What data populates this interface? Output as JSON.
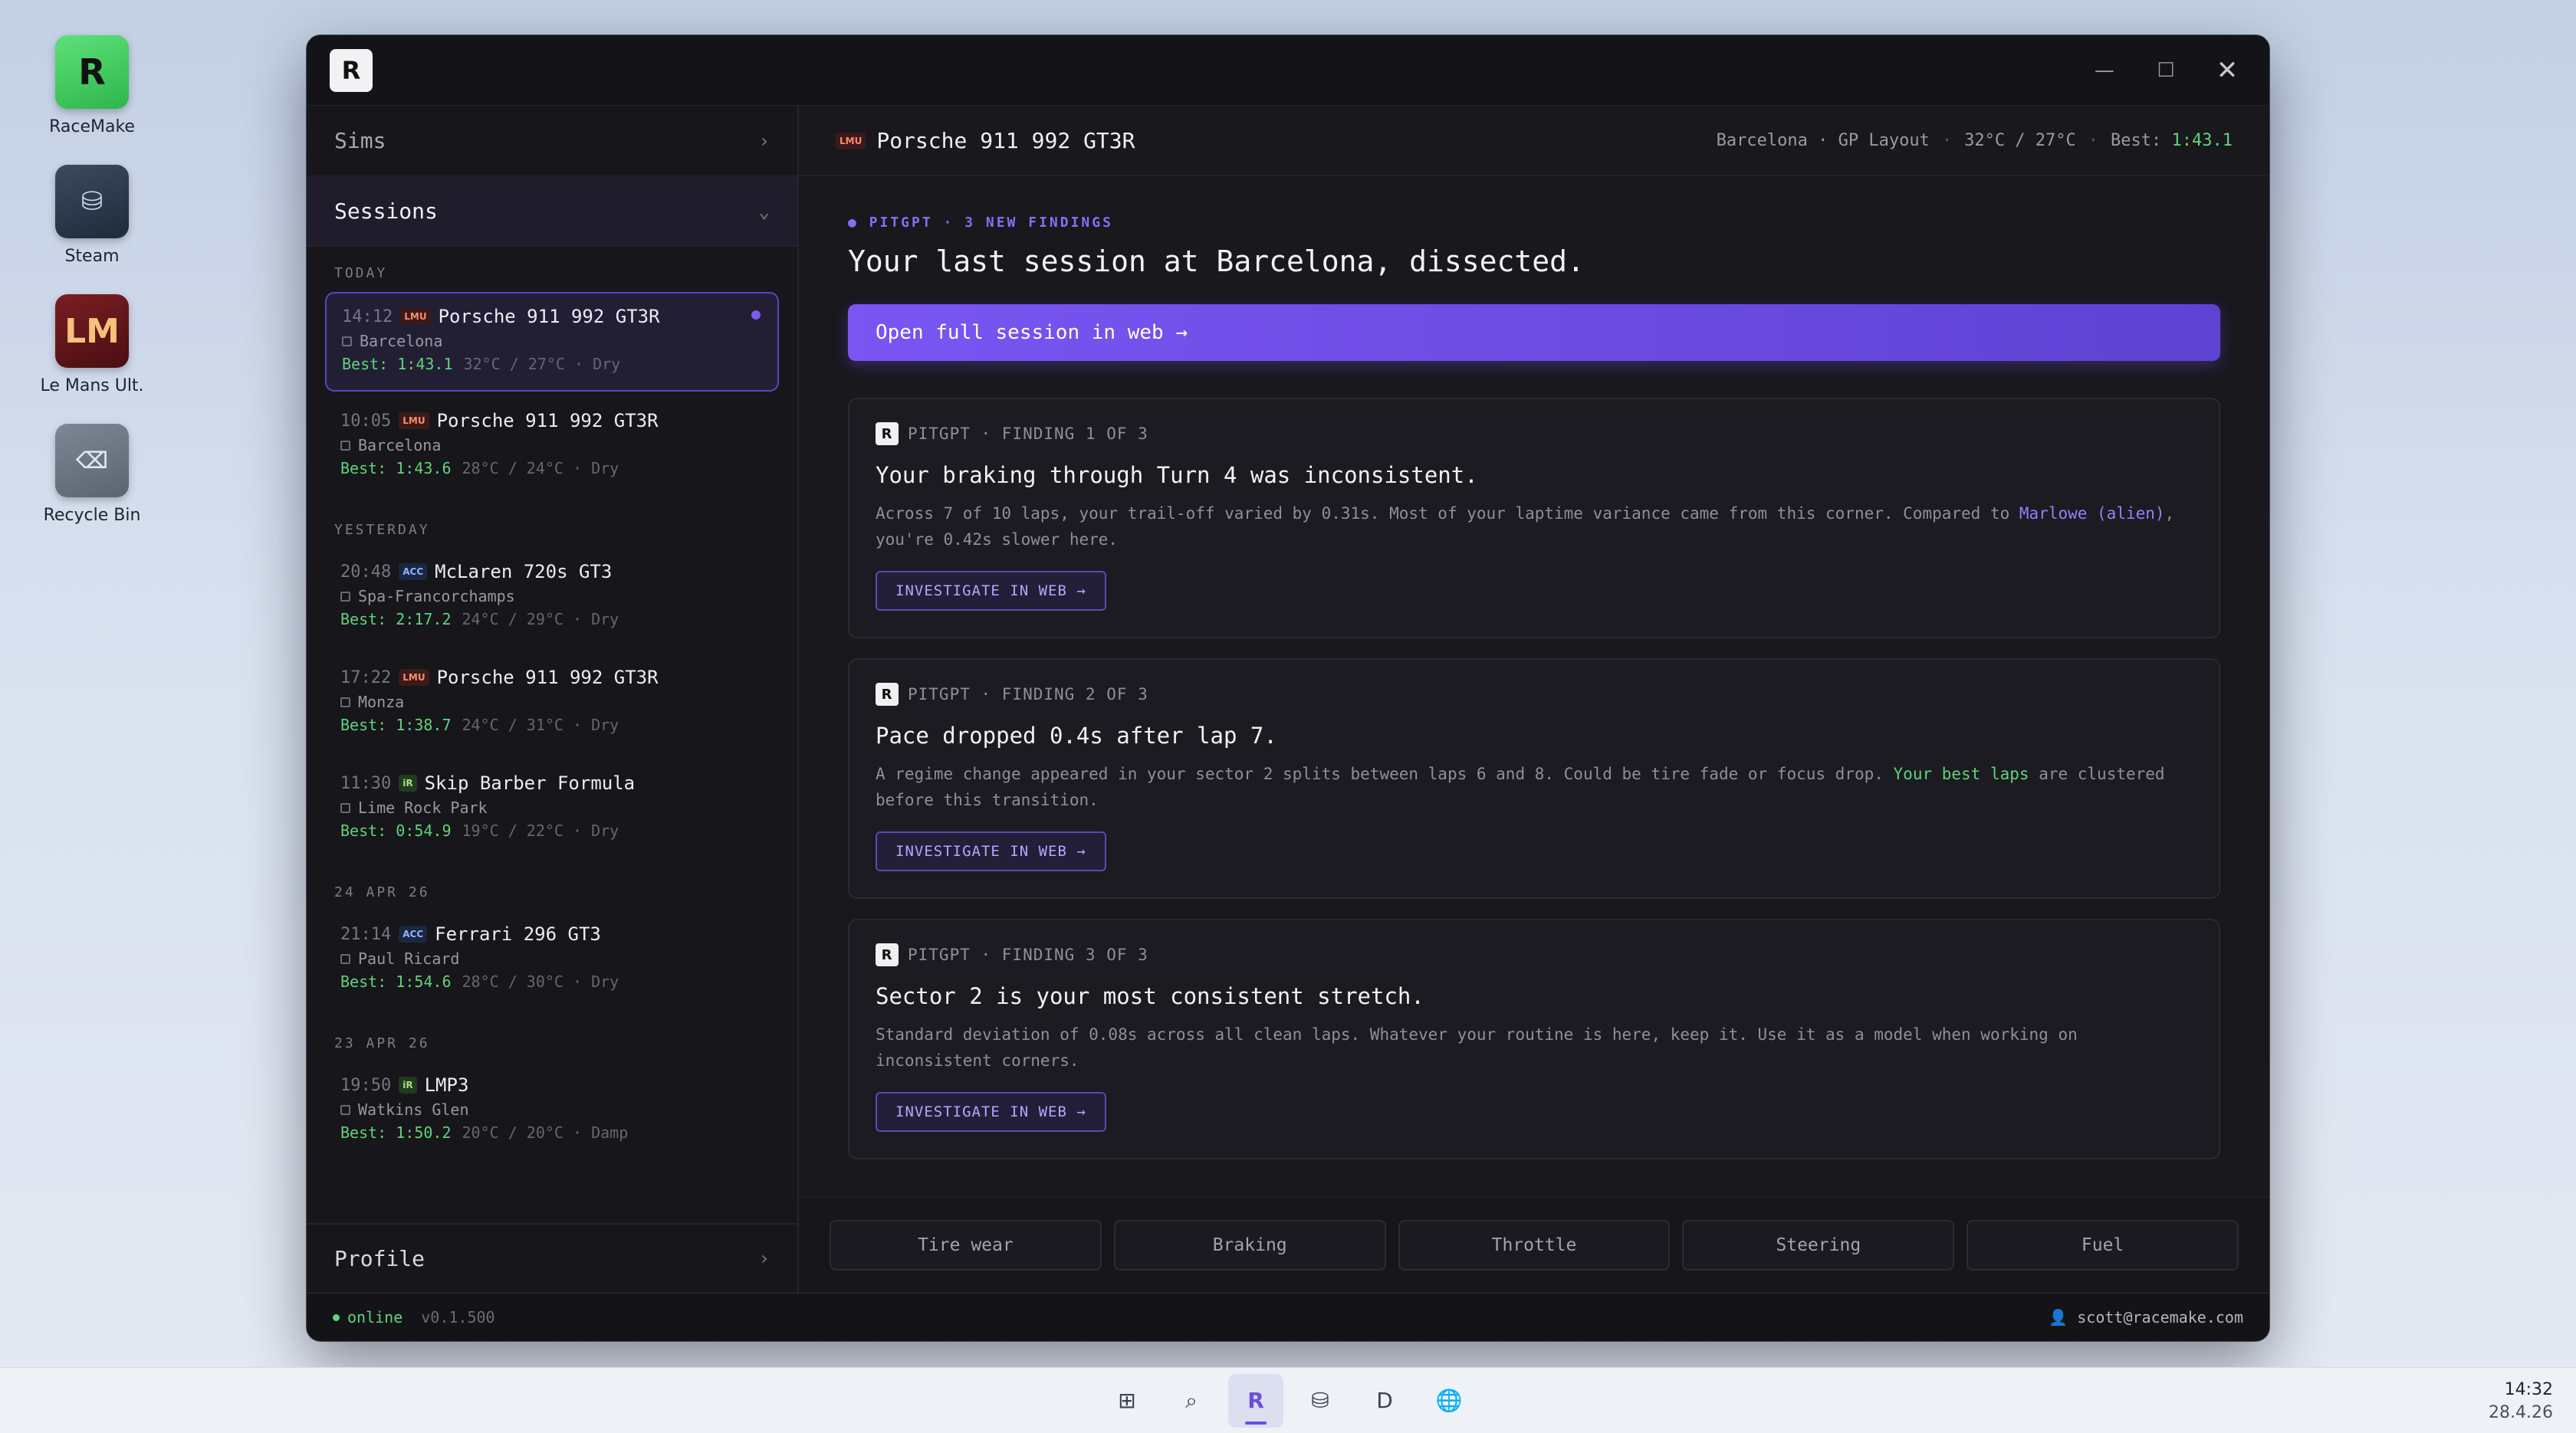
{
  "desktop": {
    "icons": [
      {
        "label": "RaceMake",
        "glyph": "R",
        "icon": "racemake-app-icon"
      },
      {
        "label": "Steam",
        "glyph": "⛁",
        "icon": "steam-app-icon"
      },
      {
        "label": "Le Mans Ult.",
        "glyph": "LM",
        "icon": "lemans-app-icon"
      },
      {
        "label": "Recycle Bin",
        "glyph": "⌫",
        "icon": "recycle-bin-icon"
      }
    ]
  },
  "window": {
    "logo": "R",
    "controls": {
      "minimize": "—",
      "maximize": "☐",
      "close": "✕"
    }
  },
  "sidebar": {
    "sims_label": "Sims",
    "sessions_label": "Sessions",
    "profile_label": "Profile",
    "chevron_right": "›",
    "chevron_down": "⌄",
    "groups": [
      {
        "label": "TODAY",
        "sessions": [
          {
            "time": "14:12",
            "sim": "LMU",
            "car": "Porsche 911 992 GT3R",
            "track": "Barcelona",
            "best": "Best: 1:43.1",
            "weather": "32°C / 27°C · Dry"
          },
          {
            "time": "10:05",
            "sim": "LMU",
            "car": "Porsche 911 992 GT3R",
            "track": "Barcelona",
            "best": "Best: 1:43.6",
            "weather": "28°C / 24°C · Dry"
          }
        ]
      },
      {
        "label": "YESTERDAY",
        "sessions": [
          {
            "time": "20:48",
            "sim": "ACC",
            "car": "McLaren 720s GT3",
            "track": "Spa-Francorchamps",
            "best": "Best: 2:17.2",
            "weather": "24°C / 29°C · Dry"
          },
          {
            "time": "17:22",
            "sim": "LMU",
            "car": "Porsche 911 992 GT3R",
            "track": "Monza",
            "best": "Best: 1:38.7",
            "weather": "24°C / 31°C · Dry"
          },
          {
            "time": "11:30",
            "sim": "iR",
            "car": "Skip Barber Formula",
            "track": "Lime Rock Park",
            "best": "Best: 0:54.9",
            "weather": "19°C / 22°C · Dry"
          }
        ]
      },
      {
        "label": "24 APR 26",
        "sessions": [
          {
            "time": "21:14",
            "sim": "ACC",
            "car": "Ferrari 296 GT3",
            "track": "Paul Ricard",
            "best": "Best: 1:54.6",
            "weather": "28°C / 30°C · Dry"
          }
        ]
      },
      {
        "label": "23 APR 26",
        "sessions": [
          {
            "time": "19:50",
            "sim": "iR",
            "car": "LMP3",
            "track": "Watkins Glen",
            "best": "Best: 1:50.2",
            "weather": "20°C / 20°C · Damp"
          }
        ]
      }
    ]
  },
  "main": {
    "header": {
      "sim": "LMU",
      "car": "Porsche 911 992 GT3R",
      "track": "Barcelona · GP Layout",
      "temps": "32°C / 27°C",
      "dot": "·",
      "best_label": "Best:",
      "best_value": "1:43.1"
    },
    "eyebrow": "● PITGPT · 3 NEW FINDINGS",
    "headline": "Your last session at Barcelona, dissected.",
    "cta": "Open full session in web →",
    "findings": [
      {
        "meta": "PITGPT · FINDING 1 OF 3",
        "title": "Your braking through Turn 4 was inconsistent.",
        "desc_before": "Across 7 of 10 laps, your trail-off varied by 0.31s. Most of your laptime variance came from this corner. Compared to ",
        "desc_highlight": "Marlowe (alien)",
        "desc_after": ", you're 0.42s slower here.",
        "action": "INVESTIGATE IN WEB →"
      },
      {
        "meta": "PITGPT · FINDING 2 OF 3",
        "title": "Pace dropped 0.4s after lap 7.",
        "desc_before": "A regime change appeared in your sector 2 splits between laps 6 and 8. Could be tire fade or focus drop. ",
        "desc_highlight": "Your best laps",
        "desc_after": " are clustered before this transition.",
        "action": "INVESTIGATE IN WEB →"
      },
      {
        "meta": "PITGPT · FINDING 3 OF 3",
        "title": "Sector 2 is your most consistent stretch.",
        "desc_before": "Standard deviation of 0.08s across all clean laps. Whatever your routine is here, keep it. Use it as a model when working on inconsistent corners.",
        "desc_highlight": "",
        "desc_after": "",
        "action": "INVESTIGATE IN WEB →"
      }
    ],
    "chips": [
      "Tire wear",
      "Braking",
      "Throttle",
      "Steering",
      "Fuel"
    ]
  },
  "statusbar": {
    "online": "online",
    "version": "v0.1.500",
    "user_icon": "👤",
    "user": "scott@racemake.com"
  },
  "taskbar": {
    "items": [
      {
        "glyph": "⊞",
        "icon": "start-icon"
      },
      {
        "glyph": "⌕",
        "icon": "search-icon"
      },
      {
        "glyph": "R",
        "icon": "racemake-taskbar-icon"
      },
      {
        "glyph": "⛁",
        "icon": "steam-taskbar-icon"
      },
      {
        "glyph": "D",
        "icon": "discord-taskbar-icon"
      },
      {
        "glyph": "🌐",
        "icon": "browser-taskbar-icon"
      }
    ],
    "time": "14:32",
    "date": "28.4.26"
  },
  "colors": {
    "accent": "#7a55f2",
    "best_green": "#5fd47a",
    "window_bg": "#141418"
  }
}
